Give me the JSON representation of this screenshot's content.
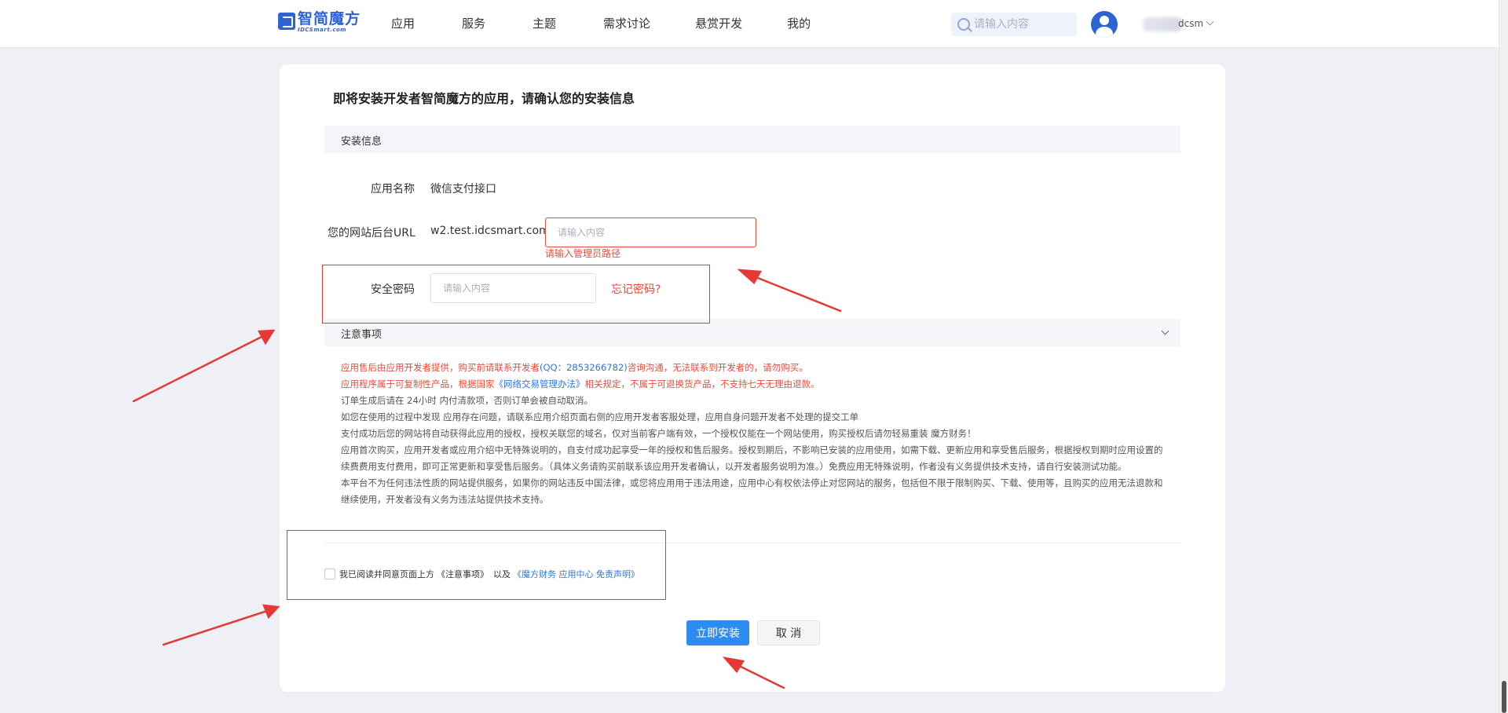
{
  "header": {
    "logo_cn": "智简魔方",
    "logo_en": "IDCSmart.com",
    "nav": [
      "应用",
      "服务",
      "主题",
      "需求讨论",
      "悬赏开发",
      "我的"
    ],
    "search_placeholder": "请输入内容",
    "username": "dcsm"
  },
  "page": {
    "title": "即将安装开发者智简魔方的应用，请确认您的安装信息",
    "install_section": "安装信息",
    "app_name_label": "应用名称",
    "app_name_value": "微信支付接口",
    "url_label": "您的网站后台URL",
    "url_prefix": "w2.test.idcsmart.com/",
    "url_placeholder": "请输入内容",
    "url_error": "请输入管理员路径",
    "password_label": "安全密码",
    "password_placeholder": "请输入内容",
    "forgot": "忘记密码?",
    "notice_section": "注意事项",
    "notes": {
      "n1_a": "应用售后由应用开发者提供，购买前请联系开发者",
      "n1_qq": "(QQ：2853266782)",
      "n1_b": "咨询沟通，无法联系到开发者的，请勿购买。",
      "n2_a": "应用程序属于可复制性产品，根据国家",
      "n2_law": "《网络交易管理办法》",
      "n2_b": "相关规定，不属于可退换货产品，不支持七天无理由退款。",
      "n3": "订单生成后请在 24小时 内付清款项，否则订单会被自动取消。",
      "n4": "如您在使用的过程中发现 应用存在问题，请联系应用介绍页面右侧的应用开发者客服处理，应用自身问题开发者不处理的提交工单",
      "n5": "支付成功后您的网站将自动获得此应用的授权，授权关联您的域名，仅对当前客户端有效，一个授权仅能在一个网站使用，购买授权后请勿轻易重装 魔方财务！",
      "n6": "应用首次购买，应用开发者或应用介绍中无特殊说明的，自支付成功起享受一年的授权和售后服务。授权到期后，不影响已安装的应用使用，如需下载、更新应用和享受售后服务，根据授权到期时应用设置的续费费用支付费用，即可正常更新和享受售后服务。（具体义务请购买前联系该应用开发者确认，以开发者服务说明为准。）免费应用无特殊说明，作者没有义务提供技术支持，请自行安装测试功能。",
      "n7": "本平台不为任何违法性质的网站提供服务，如果你的网站违反中国法律，或您将应用用于违法用途，应用中心有权依法停止对您网站的服务，包括但不限于限制购买、下载、使用等，且购买的应用无法退款和继续使用，开发者没有义务为违法站提供技术支持。"
    },
    "agree_text": "我已阅读并同意页面上方",
    "agree_notice": "《注意事项》",
    "agree_and": "以及",
    "agree_link": "《魔方财务 应用中心 免责声明》",
    "install_button": "立即安装",
    "cancel_button": "取 消"
  },
  "colors": {
    "brand": "#2e63d3",
    "primary_button": "#2d8cf0",
    "error": "#e74c3c",
    "annotation": "#e53935"
  }
}
